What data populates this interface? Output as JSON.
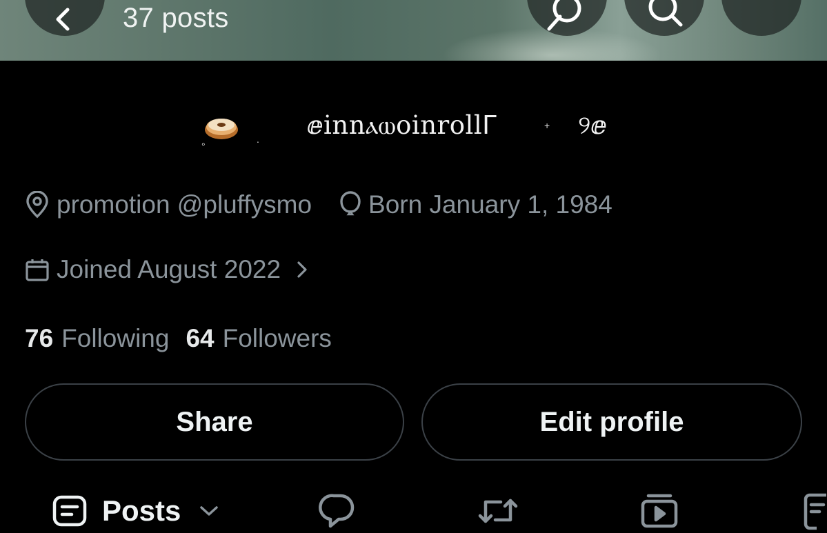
{
  "header": {
    "post_count": "37 posts"
  },
  "profile": {
    "display_name": "ⅇinnⲁⲱoinrollᒥ",
    "name_suffix": "୨ⅇ",
    "emoji": "donut",
    "location": "promotion @pluffysmo",
    "birthday": "Born January 1, 1984",
    "joined": "Joined August 2022",
    "following_count": "76",
    "following_label": "Following",
    "followers_count": "64",
    "followers_label": "Followers"
  },
  "actions": {
    "share_label": "Share",
    "edit_label": "Edit profile"
  },
  "tabs": {
    "posts_label": "Posts"
  },
  "colors": {
    "background": "#000000",
    "text_primary": "#e7e9ea",
    "text_secondary": "#8b949b",
    "border": "#3b4147"
  }
}
